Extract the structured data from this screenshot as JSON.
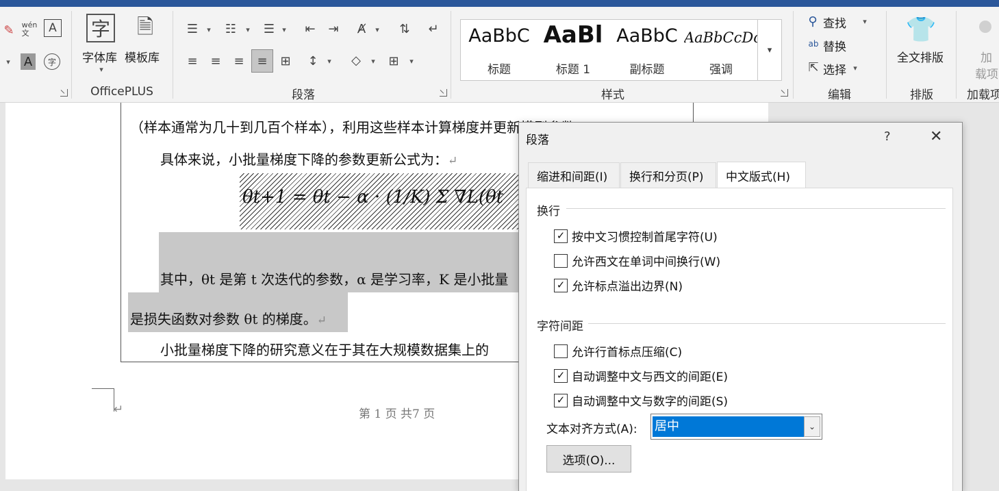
{
  "ribbon": {
    "officeplus": {
      "label": "OfficePLUS",
      "font_lib": "字体库",
      "template_lib": "模板库",
      "font_icon_char": "字",
      "pinyin_icon": "wén\n文"
    },
    "paragraph_label": "段落",
    "styles": {
      "label": "样式",
      "items": [
        {
          "sample": "AaBbC",
          "name": "标题"
        },
        {
          "sample": "AaBl",
          "name": "标题 1"
        },
        {
          "sample": "AaBbC",
          "name": "副标题"
        },
        {
          "sample": "AaBbCcDc",
          "name": "强调"
        }
      ]
    },
    "editing": {
      "label": "编辑",
      "find": "查找",
      "replace": "替换",
      "select": "选择"
    },
    "layout": {
      "label": "排版",
      "full_layout": "全文排版"
    },
    "addins": {
      "label": "加载项",
      "add_top": "加",
      "add_bottom": "载项"
    }
  },
  "document": {
    "line1": "（样本通常为几十到几百个样本），利用这些样本计算梯度并更新模型参数。",
    "line2": "具体来说，小批量梯度下降的参数更新公式为：",
    "formula": "θt+1 = θt − α · (1/K) Σ ∇L(θt",
    "line3": "其中，θt 是第  t  次迭代的参数，α 是学习率，K 是小批量",
    "line4": "是损失函数对参数  θt 的梯度。",
    "line5": "小批量梯度下降的研究意义在于其在大规模数据集上的",
    "footer": "第  1  页  共7  页",
    "para_mark": "↵"
  },
  "dialog": {
    "title": "段落",
    "help": "?",
    "close": "✕",
    "tabs": [
      {
        "label": "缩进和间距(I)",
        "active": false
      },
      {
        "label": "换行和分页(P)",
        "active": false
      },
      {
        "label": "中文版式(H)",
        "active": true
      }
    ],
    "section_wrap": "换行",
    "wrap_options": [
      {
        "label": "按中文习惯控制首尾字符(U)",
        "checked": true
      },
      {
        "label": "允许西文在单词中间换行(W)",
        "checked": false
      },
      {
        "label": "允许标点溢出边界(N)",
        "checked": true
      }
    ],
    "section_spacing": "字符间距",
    "spacing_options": [
      {
        "label": "允许行首标点压缩(C)",
        "checked": false
      },
      {
        "label": "自动调整中文与西文的间距(E)",
        "checked": true
      },
      {
        "label": "自动调整中文与数字的间距(S)",
        "checked": true
      }
    ],
    "align_label": "文本对齐方式(A):",
    "align_value": "居中",
    "options_button": "选项(O)..."
  },
  "colors": {
    "accent": "#2b579a",
    "selection": "#0078d7",
    "highlight": "#c8c8c8"
  }
}
